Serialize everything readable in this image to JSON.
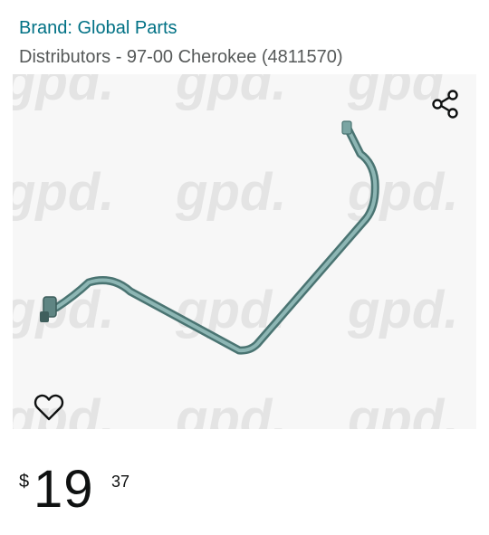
{
  "brand": {
    "text": "Brand: Global Parts"
  },
  "product": {
    "title": "Distributors - 97-00 Cherokee (4811570)"
  },
  "image": {
    "watermark": "gpd.",
    "part_color": "#6e9c9a"
  },
  "actions": {
    "share_icon": "share-icon",
    "wishlist_icon": "heart-outline-icon"
  },
  "price": {
    "symbol": "$",
    "whole": "19",
    "fraction": "37"
  },
  "colors": {
    "link": "#007185",
    "subtitle": "#565959",
    "price": "#0f1111"
  }
}
